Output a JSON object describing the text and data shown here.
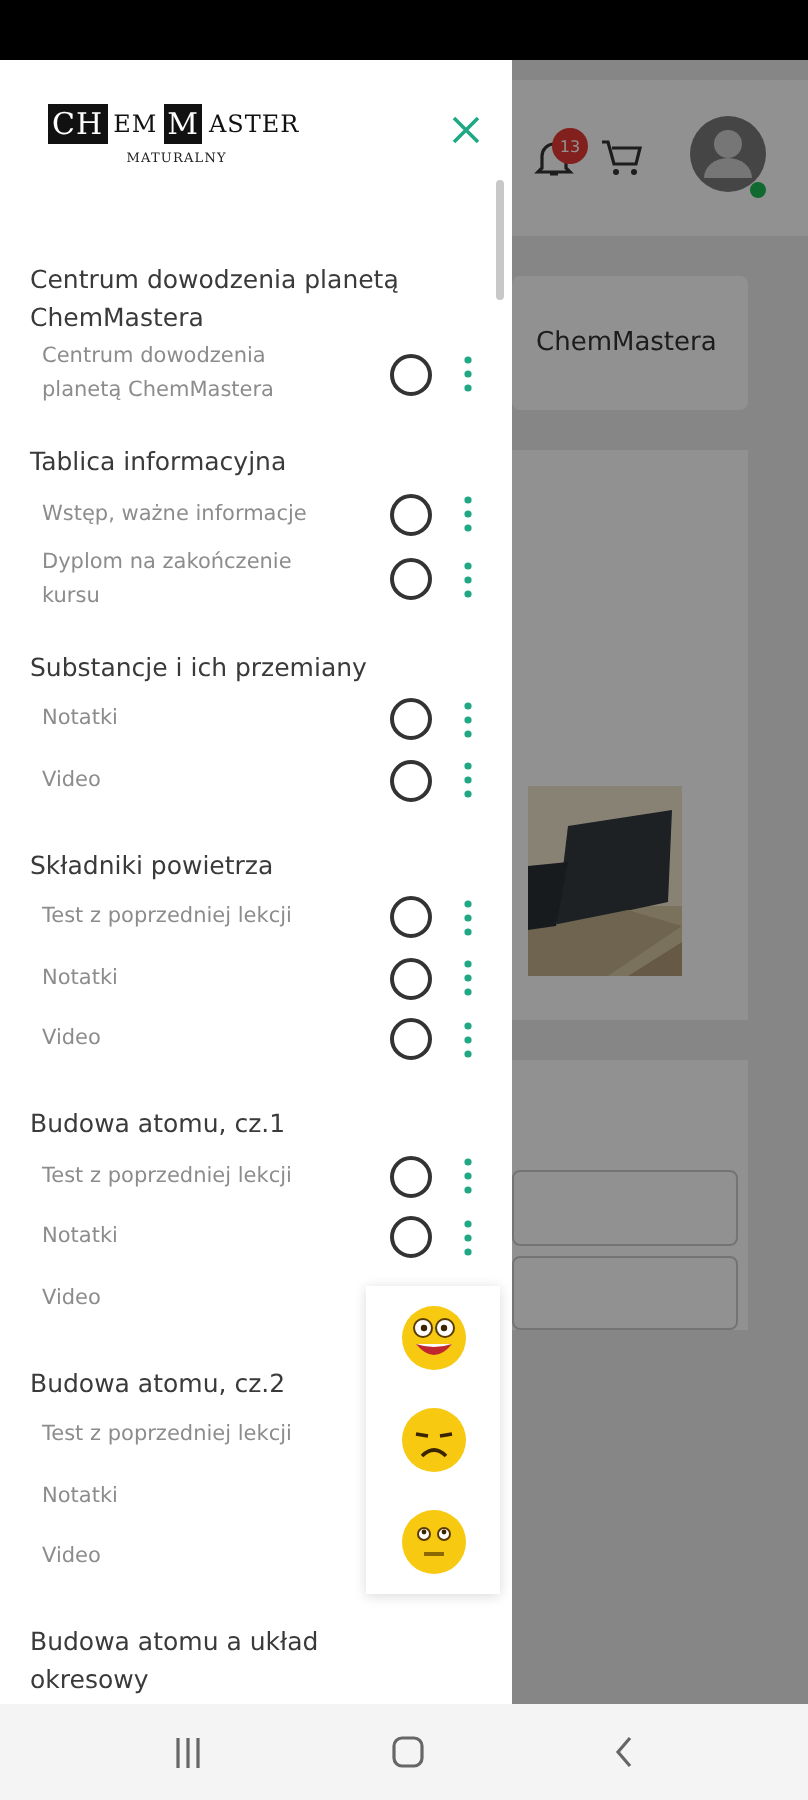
{
  "drawer": {
    "logo": {
      "letters": [
        {
          "text": "CH",
          "boxed": true
        },
        {
          "text": "EM",
          "boxed": false
        },
        {
          "text": "M",
          "boxed": true
        },
        {
          "text": "ASTER",
          "boxed": false
        }
      ],
      "subtitle": "MATURALNY"
    },
    "sections": [
      {
        "title": "Centrum dowodzenia planetą ChemMastera",
        "items": [
          {
            "label": "Centrum dowodzenia planetą ChemMastera",
            "controls": true,
            "completed": false
          }
        ]
      },
      {
        "title": "Tablica informacyjna",
        "items": [
          {
            "label": "Wstęp, ważne informacje",
            "controls": true,
            "completed": false
          },
          {
            "label": "Dyplom na zakończenie kursu",
            "controls": true,
            "completed": false
          }
        ]
      },
      {
        "title": "Substancje i ich przemiany",
        "items": [
          {
            "label": "Notatki",
            "controls": true,
            "completed": false
          },
          {
            "label": "Video",
            "controls": true,
            "completed": false
          }
        ]
      },
      {
        "title": "Składniki powietrza",
        "items": [
          {
            "label": "Test z poprzedniej lekcji",
            "controls": true,
            "completed": false
          },
          {
            "label": "Notatki",
            "controls": true,
            "completed": false
          },
          {
            "label": "Video",
            "controls": true,
            "completed": false
          }
        ]
      },
      {
        "title": "Budowa atomu, cz.1",
        "items": [
          {
            "label": "Test z poprzedniej lekcji",
            "controls": true,
            "completed": false
          },
          {
            "label": "Notatki",
            "controls": true,
            "completed": false
          },
          {
            "label": "Video"
          }
        ]
      },
      {
        "title": "Budowa atomu, cz.2",
        "items": [
          {
            "label": "Test z poprzedniej lekcji"
          },
          {
            "label": "Notatki"
          },
          {
            "label": "Video"
          }
        ]
      },
      {
        "title": "Budowa atomu a układ okresowy"
      }
    ]
  },
  "reactions": [
    {
      "kind": "surprised"
    },
    {
      "kind": "sad"
    },
    {
      "kind": "neutral"
    }
  ],
  "background": {
    "notifications": "13",
    "online": true,
    "card_title": "ChemMastera"
  }
}
